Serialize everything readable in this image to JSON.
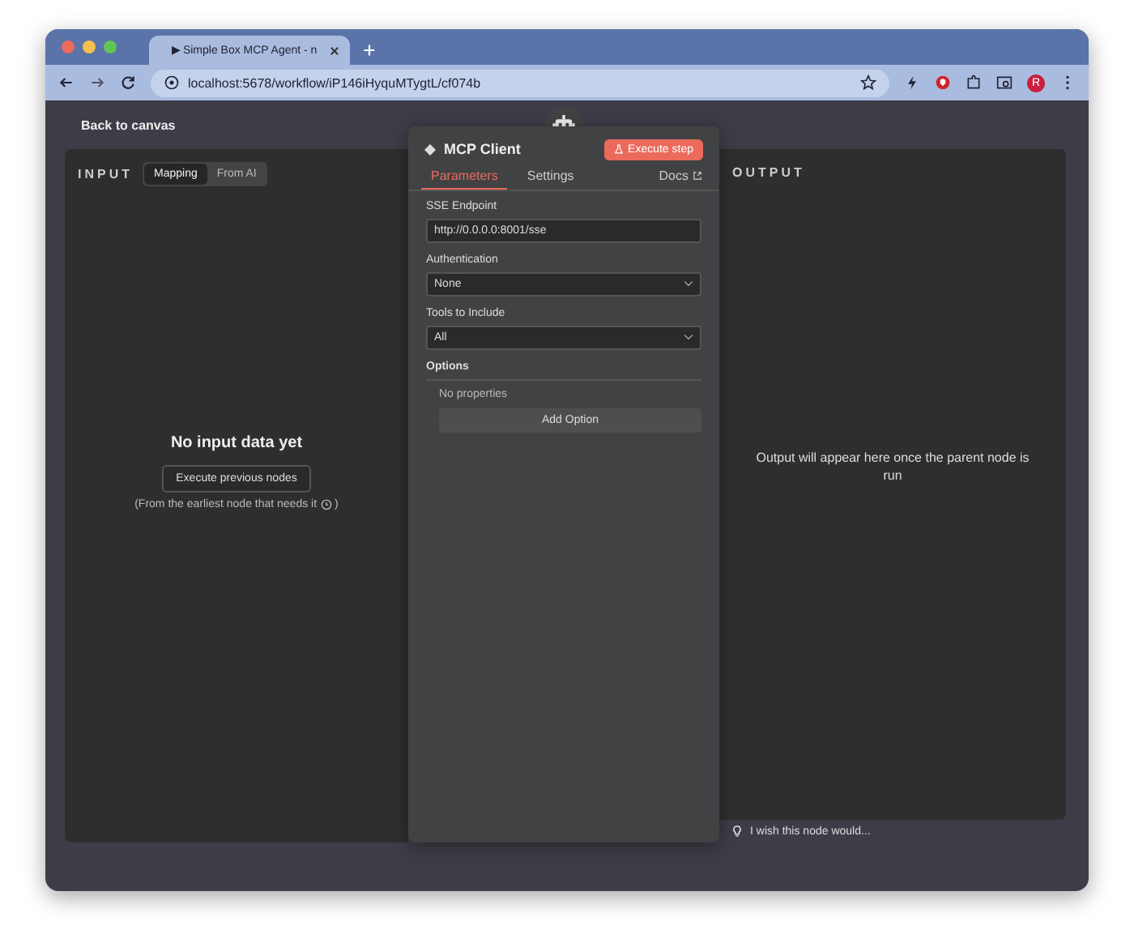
{
  "browser": {
    "tab_title": "▶ Simple Box MCP Agent - n",
    "url": "localhost:5678/workflow/iP146iHyquMTygtL/cf074b",
    "profile_initial": "R"
  },
  "back_link": "Back to canvas",
  "input_panel": {
    "title": "INPUT",
    "modes": [
      {
        "label": "Mapping",
        "selected": true
      },
      {
        "label": "From AI",
        "selected": false
      }
    ],
    "empty_title": "No input data yet",
    "action": "Execute previous nodes",
    "hint": "(From the earliest node that needs it",
    "hint_end": ")"
  },
  "node": {
    "name": "MCP Client",
    "execute": "Execute step",
    "tabs": [
      {
        "label": "Parameters",
        "selected": true
      },
      {
        "label": "Settings",
        "selected": false
      }
    ],
    "docs": "Docs",
    "fields": [
      {
        "kind": "text",
        "label": "SSE Endpoint",
        "value": "http://0.0.0.0:8001/sse"
      },
      {
        "kind": "select",
        "label": "Authentication",
        "value": "None"
      },
      {
        "kind": "select",
        "label": "Tools to Include",
        "value": "All"
      }
    ],
    "options": {
      "title": "Options",
      "empty": "No properties",
      "add": "Add Option"
    }
  },
  "output_panel": {
    "title": "OUTPUT",
    "message": "Output will appear here once the parent node is run"
  },
  "feedback": "I wish this node would..."
}
